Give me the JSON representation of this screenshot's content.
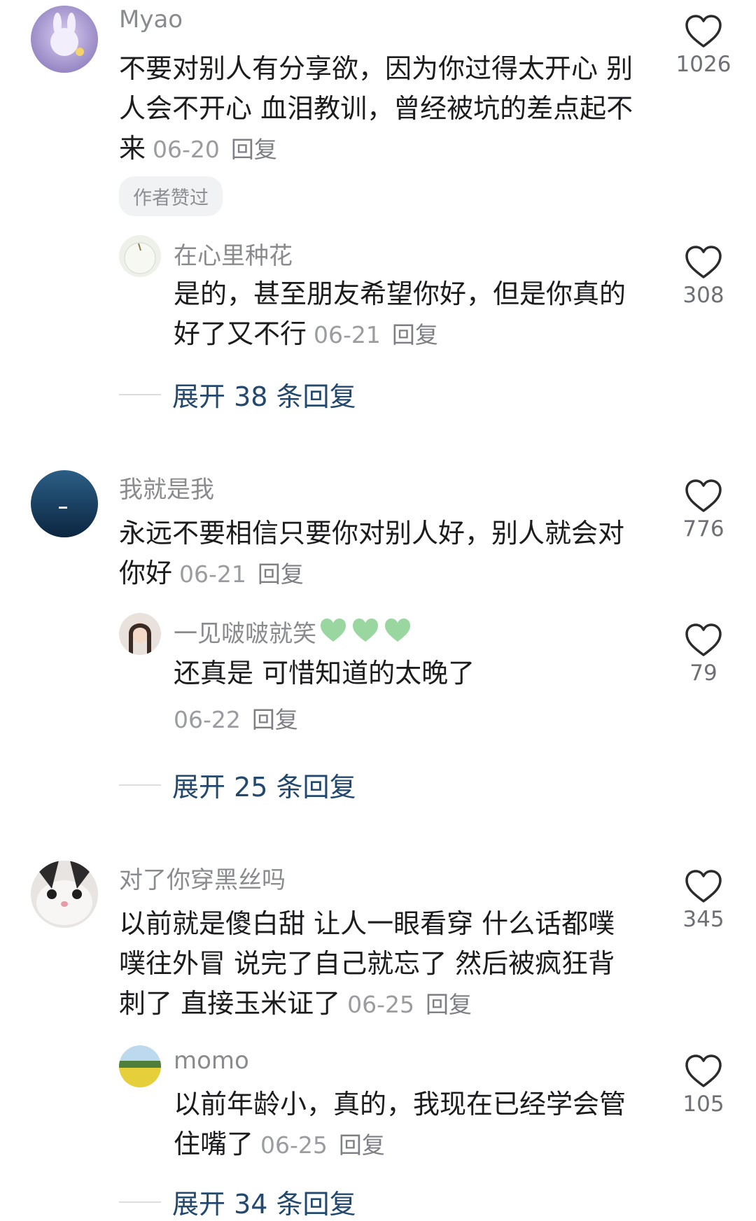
{
  "comments": [
    {
      "user": "Myao",
      "text": "不要对别人有分享欲，因为你过得太开心 别人会不开心 血泪教训，曾经被坑的差点起不来",
      "date": "06-20",
      "reply_label": "回复",
      "likes": "1026",
      "badge": "作者赞过",
      "replies": [
        {
          "user": "在心里种花",
          "text": "是的，甚至朋友希望你好，但是你真的好了又不行",
          "date": "06-21",
          "reply_label": "回复",
          "likes": "308"
        }
      ],
      "expand_label": "展开 38 条回复"
    },
    {
      "user": "我就是我",
      "text": "永远不要相信只要你对别人好，别人就会对你好",
      "date": "06-21",
      "reply_label": "回复",
      "likes": "776",
      "replies": [
        {
          "user": "一见啵啵就笑",
          "text": "还真是 可惜知道的太晚了",
          "date": "06-22",
          "reply_label": "回复",
          "likes": "79"
        }
      ],
      "expand_label": "展开 25 条回复"
    },
    {
      "user": "对了你穿黑丝吗",
      "text": "以前就是傻白甜 让人一眼看穿 什么话都噗噗往外冒 说完了自己就忘了 然后被疯狂背刺了 直接玉米证了",
      "date": "06-25",
      "reply_label": "回复",
      "likes": "345",
      "replies": [
        {
          "user": "momo",
          "text": "以前年龄小，真的，我现在已经学会管住嘴了",
          "date": "06-25",
          "reply_label": "回复",
          "likes": "105"
        }
      ],
      "expand_label": "展开 34 条回复"
    }
  ],
  "colors": {
    "heart_outline": "#2b2b2d",
    "green_heart": "#9ad7a0",
    "expand_text": "#23496e"
  },
  "icons": {
    "like": "heart-outline-icon",
    "emoji": "green-heart-icon"
  }
}
